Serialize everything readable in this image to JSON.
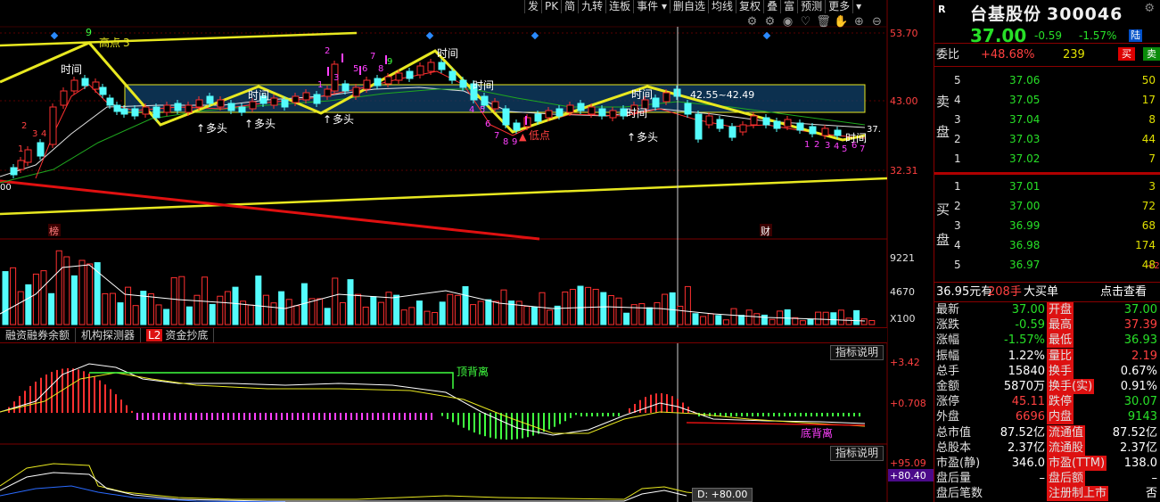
{
  "toolbar": [
    "发",
    "PK",
    "简",
    "九转",
    "连板",
    "事件 ▾",
    "删自选",
    "均线",
    "复权",
    "叠",
    "富",
    "预测",
    "更多",
    "▾"
  ],
  "tool_icons": [
    "gear-icon",
    "settings-icon",
    "eye-icon",
    "heart-icon",
    "trash-icon",
    "hand-icon",
    "zoom-in-icon",
    "zoom-out-icon"
  ],
  "chart": {
    "price_axis": [
      "53.70",
      "43.00",
      "32.31"
    ],
    "volume_axis": [
      "9221",
      "4670",
      "X100"
    ],
    "macd_axis": [
      "+3.42",
      "+0.708"
    ],
    "kdj_axis": [
      "+95.09",
      "+80.40"
    ],
    "labels": {
      "high_point": "高点",
      "low_point": "低点",
      "time": "时间",
      "duotou": "多头",
      "range": "42.55~42.49",
      "left_cut": "00",
      "right_cut": "37.",
      "top_divergence": "顶背离",
      "bottom_divergence": "底背离",
      "bang": "榜",
      "cai": "财",
      "high_suffix": "3"
    },
    "subbar": [
      "融资融券余额",
      "机构探测器",
      "资金抄底"
    ],
    "l2": "L2",
    "ind_btn": "指标说明",
    "d_value": "D: +80.00",
    "highlight_color": "#e8e820",
    "up_color": "#ff3030",
    "down_color": "#54fcfc"
  },
  "panel": {
    "badge": "R",
    "name": "台基股份",
    "code": "300046",
    "menu": "⚙",
    "price": "37.00",
    "change": "-0.59",
    "pct": "-1.57%",
    "tag": "陆",
    "weibi_label": "委比",
    "weibi_pct": "+48.68%",
    "weibi_val": "239",
    "sell_btn": "买",
    "buy_btn": "卖",
    "sell_side": "卖盘",
    "buy_side": "买盘",
    "asks": [
      {
        "lv": "5",
        "p": "37.06",
        "v": "50"
      },
      {
        "lv": "4",
        "p": "37.05",
        "v": "17"
      },
      {
        "lv": "3",
        "p": "37.04",
        "v": "8"
      },
      {
        "lv": "2",
        "p": "37.03",
        "v": "44"
      },
      {
        "lv": "1",
        "p": "37.02",
        "v": "7"
      }
    ],
    "bids": [
      {
        "lv": "1",
        "p": "37.01",
        "v": "3"
      },
      {
        "lv": "2",
        "p": "37.00",
        "v": "72"
      },
      {
        "lv": "3",
        "p": "36.99",
        "v": "68"
      },
      {
        "lv": "4",
        "p": "36.98",
        "v": "174"
      },
      {
        "lv": "5",
        "p": "36.97",
        "v": "48"
      }
    ],
    "bid_extra": "+2",
    "big_a": "36.95元有",
    "big_b": "208手",
    "big_c": "大买单",
    "big_d": "点击查看",
    "stats": [
      {
        "l1": "最新",
        "v1": "37.00",
        "c1": "green",
        "l2": "开盘",
        "v2": "37.00",
        "c2": "green"
      },
      {
        "l1": "涨跌",
        "v1": "-0.59",
        "c1": "green",
        "l2": "最高",
        "v2": "37.39",
        "c2": "red"
      },
      {
        "l1": "涨幅",
        "v1": "-1.57%",
        "c1": "green",
        "l2": "最低",
        "v2": "36.93",
        "c2": "green"
      },
      {
        "l1": "振幅",
        "v1": "1.22%",
        "c1": "white",
        "l2": "量比",
        "v2": "2.19",
        "c2": "red"
      },
      {
        "l1": "总手",
        "v1": "15840",
        "c1": "white",
        "l2": "换手",
        "v2": "0.67%",
        "c2": "white"
      },
      {
        "l1": "金额",
        "v1": "5870万",
        "c1": "white",
        "l2": "换手(实)",
        "v2": "0.91%",
        "c2": "white"
      },
      {
        "l1": "涨停",
        "v1": "45.11",
        "c1": "red",
        "l2": "跌停",
        "v2": "30.07",
        "c2": "green"
      },
      {
        "l1": "外盘",
        "v1": "6696",
        "c1": "red",
        "l2": "内盘",
        "v2": "9143",
        "c2": "green"
      },
      {
        "l1": "总市值",
        "v1": "87.52亿",
        "c1": "white",
        "l2": "流通值",
        "v2": "87.52亿",
        "c2": "white"
      },
      {
        "l1": "总股本",
        "v1": "2.37亿",
        "c1": "white",
        "l2": "流通股",
        "v2": "2.37亿",
        "c2": "white"
      },
      {
        "l1": "市盈(静)",
        "v1": "346.0",
        "c1": "white",
        "l2": "市盈(TTM)",
        "v2": "138.0",
        "c2": "white"
      },
      {
        "l1": "盘后量",
        "v1": "–",
        "c1": "white",
        "l2": "盘后额",
        "v2": "–",
        "c2": "white"
      },
      {
        "l1": "盘后笔数",
        "v1": "",
        "c1": "white",
        "l2": "注册制上市",
        "v2": "否",
        "c2": "white"
      }
    ]
  }
}
